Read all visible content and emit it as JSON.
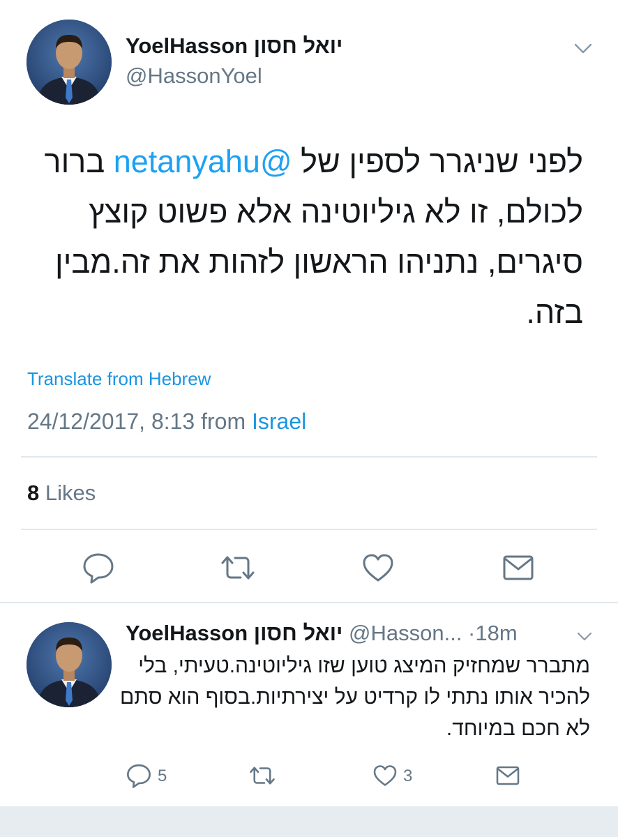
{
  "colors": {
    "link": "#1b95e0",
    "text": "#14171a",
    "secondary": "#657786",
    "divider": "#e1e8ed"
  },
  "main_tweet": {
    "display_name": "YoelHasson יואל חסון",
    "handle": "@HassonYoel",
    "text_part1": "לפני שניגרר לספין של ",
    "mention": "@netanyahu",
    "text_part2": " ברור לכולם, זו לא גיליוטינה אלא פשוט קוצץ סיגרים, נתניהו הראשון לזהות את זה.מבין בזה.",
    "translate_label": "Translate from Hebrew",
    "timestamp": "24/12/2017, 8:13 from ",
    "location": "Israel",
    "likes_count": "8",
    "likes_label": " Likes",
    "icons": [
      "chevron-down-icon",
      "reply-icon",
      "retweet-icon",
      "like-icon",
      "direct-message-icon"
    ]
  },
  "reply_tweet": {
    "display_name": "YoelHasson יואל חסון",
    "handle": " @Hasson...",
    "time": " ·18m",
    "text": "מתברר שמחזיק המיצג טוען שזו גיליוטינה.טעיתי, בלי להכיר אותו נתתי לו קרדיט על יצירתיות.בסוף הוא סתם לא חכם במיוחד.",
    "reply_count": "5",
    "like_count": "3"
  }
}
